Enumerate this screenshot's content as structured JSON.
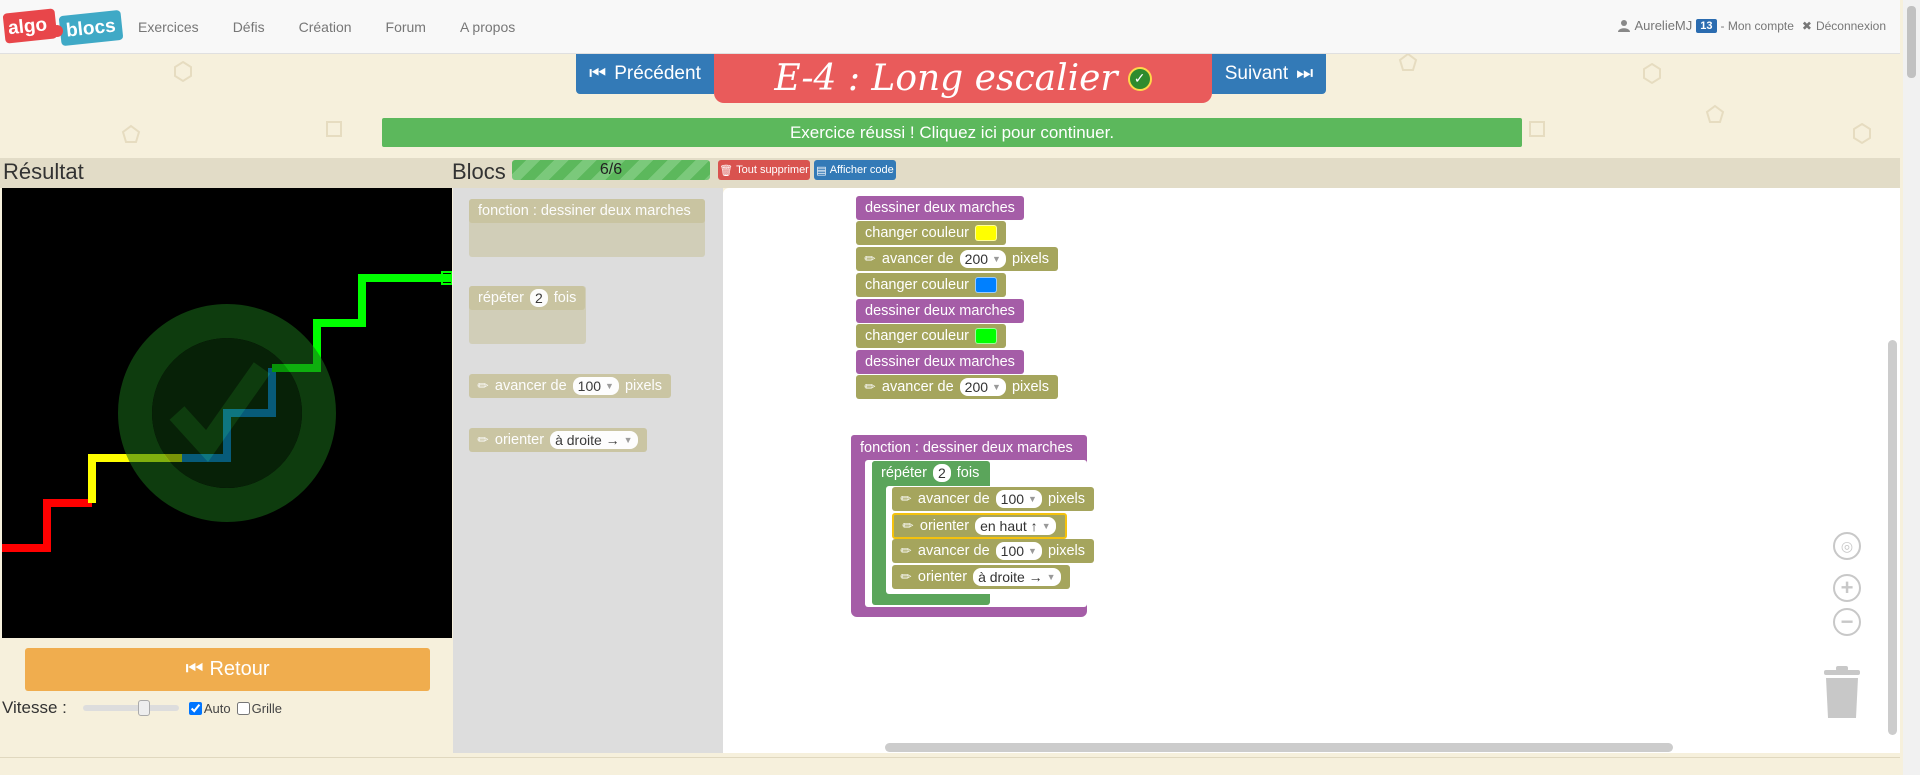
{
  "nav": {
    "logo_left": "algo",
    "logo_right": "blocs",
    "links": [
      "Exercices",
      "Défis",
      "Création",
      "Forum",
      "A propos"
    ],
    "user": "AurelieMJ",
    "user_badge": "13",
    "account": "- Mon compte",
    "logout": "Déconnexion"
  },
  "exercise": {
    "prev": "Précédent",
    "title": "E-4 : Long escalier",
    "next": "Suivant",
    "success": "Exercice réussi ! Cliquez ici pour continuer."
  },
  "result": {
    "label": "Résultat",
    "retour": "Retour",
    "speed_label": "Vitesse :",
    "auto_label": "Auto",
    "auto_checked": true,
    "grid_label": "Grille",
    "grid_checked": false,
    "speed_level": 0.6
  },
  "blocks_panel": {
    "label": "Blocs",
    "progress": "6/6",
    "delete_all": "Tout supprimer",
    "show_code": "Afficher code"
  },
  "toolbox": {
    "function_block": "fonction : dessiner deux marches",
    "repeat_pre": "répéter",
    "repeat_count": "2",
    "repeat_post": "fois",
    "forward_pre": "avancer de",
    "forward_value": "100",
    "forward_post": "pixels",
    "orient_pre": "orienter",
    "orient_value": "à droite →"
  },
  "program": {
    "draw_two_steps": "dessiner deux marches",
    "change_color": "changer couleur",
    "forward_pre": "avancer de",
    "forward_200": "200",
    "pixels": "pixels",
    "colors": [
      "#ffff00",
      "#0080ff",
      "#00ff00"
    ]
  },
  "function_def": {
    "header": "fonction : dessiner deux marches",
    "repeat_pre": "répéter",
    "repeat_count": "2",
    "repeat_post": "fois",
    "forward_pre": "avancer de",
    "forward_value": "100",
    "pixels": "pixels",
    "orient_pre": "orienter",
    "orient_up": "en haut ↑",
    "orient_right": "à droite →"
  },
  "colors": {
    "red": "#ff0000",
    "yellow": "#ffff00",
    "blue": "#0080ff",
    "green": "#00ff00",
    "success": "#5cb85c",
    "title_bg": "#e95b5b",
    "primary": "#337ab7"
  }
}
